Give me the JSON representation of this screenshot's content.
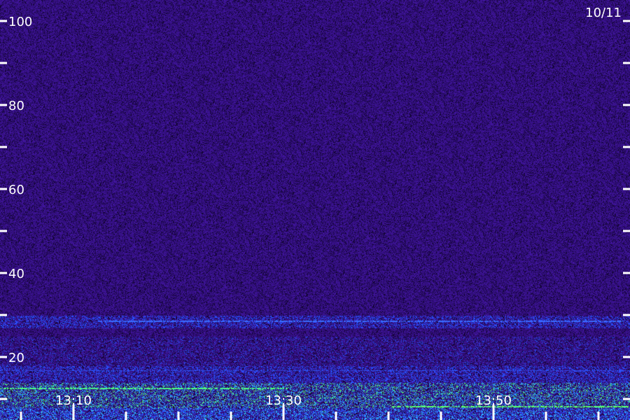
{
  "chart_data": {
    "type": "heatmap",
    "title": "",
    "date_label": "10/11",
    "xlabel": "",
    "ylabel": "",
    "x_range": [
      "13:03",
      "14:03"
    ],
    "y_range": [
      0,
      100
    ],
    "x_tick_labels": [
      {
        "label": "13:10",
        "time_min": 10
      },
      {
        "label": "13:30",
        "time_min": 30
      },
      {
        "label": "13:50",
        "time_min": 50
      }
    ],
    "x_minor_ticks_min": [
      5,
      10,
      15,
      20,
      25,
      30,
      35,
      40,
      45,
      50,
      55,
      60
    ],
    "y_tick_labels": [
      {
        "label": "20",
        "value": 20
      },
      {
        "label": "40",
        "value": 40
      },
      {
        "label": "60",
        "value": 60
      },
      {
        "label": "80",
        "value": 80
      },
      {
        "label": "100",
        "value": 100
      }
    ],
    "y_minor_ticks": [
      10,
      30,
      50,
      70,
      90
    ],
    "colors": {
      "background": "#2a0a6e",
      "noise_dark": "#14043c",
      "noise_light": "#4a1aa8",
      "band_blue": "#2a5cff",
      "band_cyan": "#30d8ff",
      "band_green": "#3cff60",
      "axis": "#ffffff"
    },
    "bands": [
      {
        "value_low": 0,
        "value_high": 3,
        "intensity": "green-cyan"
      },
      {
        "value_low": 3,
        "value_high": 8,
        "intensity": "blue-cyan"
      },
      {
        "value_low": 8,
        "value_high": 14,
        "intensity": "green"
      },
      {
        "value_low": 14,
        "value_high": 18,
        "intensity": "blue"
      },
      {
        "value_low": 18,
        "value_high": 25,
        "intensity": "weak-blue"
      },
      {
        "value_low": 27,
        "value_high": 30,
        "intensity": "blue"
      }
    ]
  }
}
